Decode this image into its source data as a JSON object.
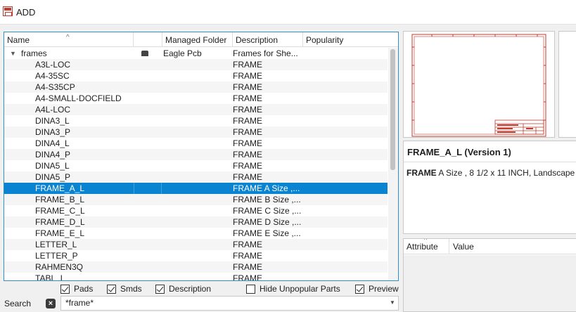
{
  "window": {
    "title": "ADD"
  },
  "columns": {
    "name": "Name",
    "folder": "Managed Folder",
    "description": "Description",
    "popularity": "Popularity"
  },
  "group": {
    "name": "frames",
    "folder": "Eagle Pcb",
    "description": "Frames for She..."
  },
  "rows": [
    {
      "name": "A3L-LOC",
      "description": "FRAME"
    },
    {
      "name": "A4-35SC",
      "description": "FRAME"
    },
    {
      "name": "A4-S35CP",
      "description": "FRAME"
    },
    {
      "name": "A4-SMALL-DOCFIELD",
      "description": "FRAME"
    },
    {
      "name": "A4L-LOC",
      "description": "FRAME"
    },
    {
      "name": "DINA3_L",
      "description": "FRAME"
    },
    {
      "name": "DINA3_P",
      "description": "FRAME"
    },
    {
      "name": "DINA4_L",
      "description": "FRAME"
    },
    {
      "name": "DINA4_P",
      "description": "FRAME"
    },
    {
      "name": "DINA5_L",
      "description": "FRAME"
    },
    {
      "name": "DINA5_P",
      "description": "FRAME"
    },
    {
      "name": "FRAME_A_L",
      "description": "FRAME A Size ,..."
    },
    {
      "name": "FRAME_B_L",
      "description": "FRAME B Size ,..."
    },
    {
      "name": "FRAME_C_L",
      "description": "FRAME C Size ,..."
    },
    {
      "name": "FRAME_D_L",
      "description": "FRAME D Size ,..."
    },
    {
      "name": "FRAME_E_L",
      "description": "FRAME E Size ,..."
    },
    {
      "name": "LETTER_L",
      "description": "FRAME"
    },
    {
      "name": "LETTER_P",
      "description": "FRAME"
    },
    {
      "name": "RAHMEN3Q",
      "description": "FRAME"
    },
    {
      "name": "TABL_L",
      "description": "FRAME"
    }
  ],
  "selected_row": "FRAME_A_L",
  "options": {
    "pads": {
      "label": "Pads",
      "checked": true
    },
    "smds": {
      "label": "Smds",
      "checked": true
    },
    "description": {
      "label": "Description",
      "checked": true
    },
    "hide_unpopular": {
      "label": "Hide Unpopular Parts",
      "checked": false
    },
    "preview": {
      "label": "Preview",
      "checked": true
    }
  },
  "search": {
    "label": "Search",
    "value": "*frame*"
  },
  "info": {
    "title": "FRAME_A_L (Version 1)",
    "desc_bold": "FRAME",
    "desc_rest": " A Size , 8 1/2 x 11 INCH, Landscape"
  },
  "attributes": {
    "col_attribute": "Attribute",
    "col_value": "Value"
  },
  "colors": {
    "selection": "#0a84d1",
    "frame_red": "#c0392b",
    "focus_border": "#2f8fc6"
  }
}
